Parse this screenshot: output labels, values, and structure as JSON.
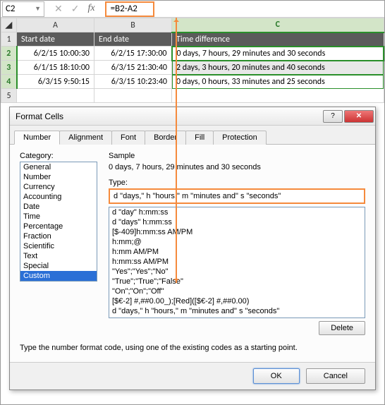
{
  "formula_bar": {
    "name_box": "C2",
    "formula": "=B2-A2"
  },
  "grid": {
    "columns": [
      "A",
      "B",
      "C"
    ],
    "headers": [
      "Start date",
      "End date",
      "Time difference"
    ],
    "rows": [
      {
        "n": "2",
        "a": "6/2/15 10:00:30",
        "b": "6/2/15 17:30:00",
        "c": "0 days, 7 hours, 29 minutes and 30 seconds"
      },
      {
        "n": "3",
        "a": "6/1/15 18:10:00",
        "b": "6/3/15 21:30:40",
        "c": "2 days, 3 hours, 20 minutes and 40 seconds"
      },
      {
        "n": "4",
        "a": "6/3/15 9:50:15",
        "b": "6/3/15 10:23:40",
        "c": "0 days, 0 hours, 33 minutes and 25 seconds"
      }
    ]
  },
  "dialog": {
    "title": "Format Cells",
    "tabs": [
      "Number",
      "Alignment",
      "Font",
      "Border",
      "Fill",
      "Protection"
    ],
    "category_label": "Category:",
    "sample_label": "Sample",
    "sample_value": "0 days, 7 hours, 29 minutes and 30 seconds",
    "type_label": "Type:",
    "type_value": "d \"days,\" h \"hours,\" m \"minutes and\" s \"seconds\"",
    "categories": [
      "General",
      "Number",
      "Currency",
      "Accounting",
      "Date",
      "Time",
      "Percentage",
      "Fraction",
      "Scientific",
      "Text",
      "Special",
      "Custom"
    ],
    "type_list": [
      "d \"day\" h:mm:ss",
      "d \"days\" h:mm:ss",
      "[$-409]h:mm:ss AM/PM",
      "h:mm;@",
      " h:mm AM/PM",
      "h:mm:ss AM/PM",
      "\"Yes\";\"Yes\";\"No\"",
      "\"True\";\"True\";\"False\"",
      "\"On\";\"On\";\"Off\"",
      "[$€-2] #,##0.00_);[Red]([$€-2] #,##0.00)",
      "d \"days,\" h \"hours,\" m \"minutes and\" s \"seconds\""
    ],
    "delete": "Delete",
    "hint": "Type the number format code, using one of the existing codes as a starting point.",
    "ok": "OK",
    "cancel": "Cancel"
  }
}
